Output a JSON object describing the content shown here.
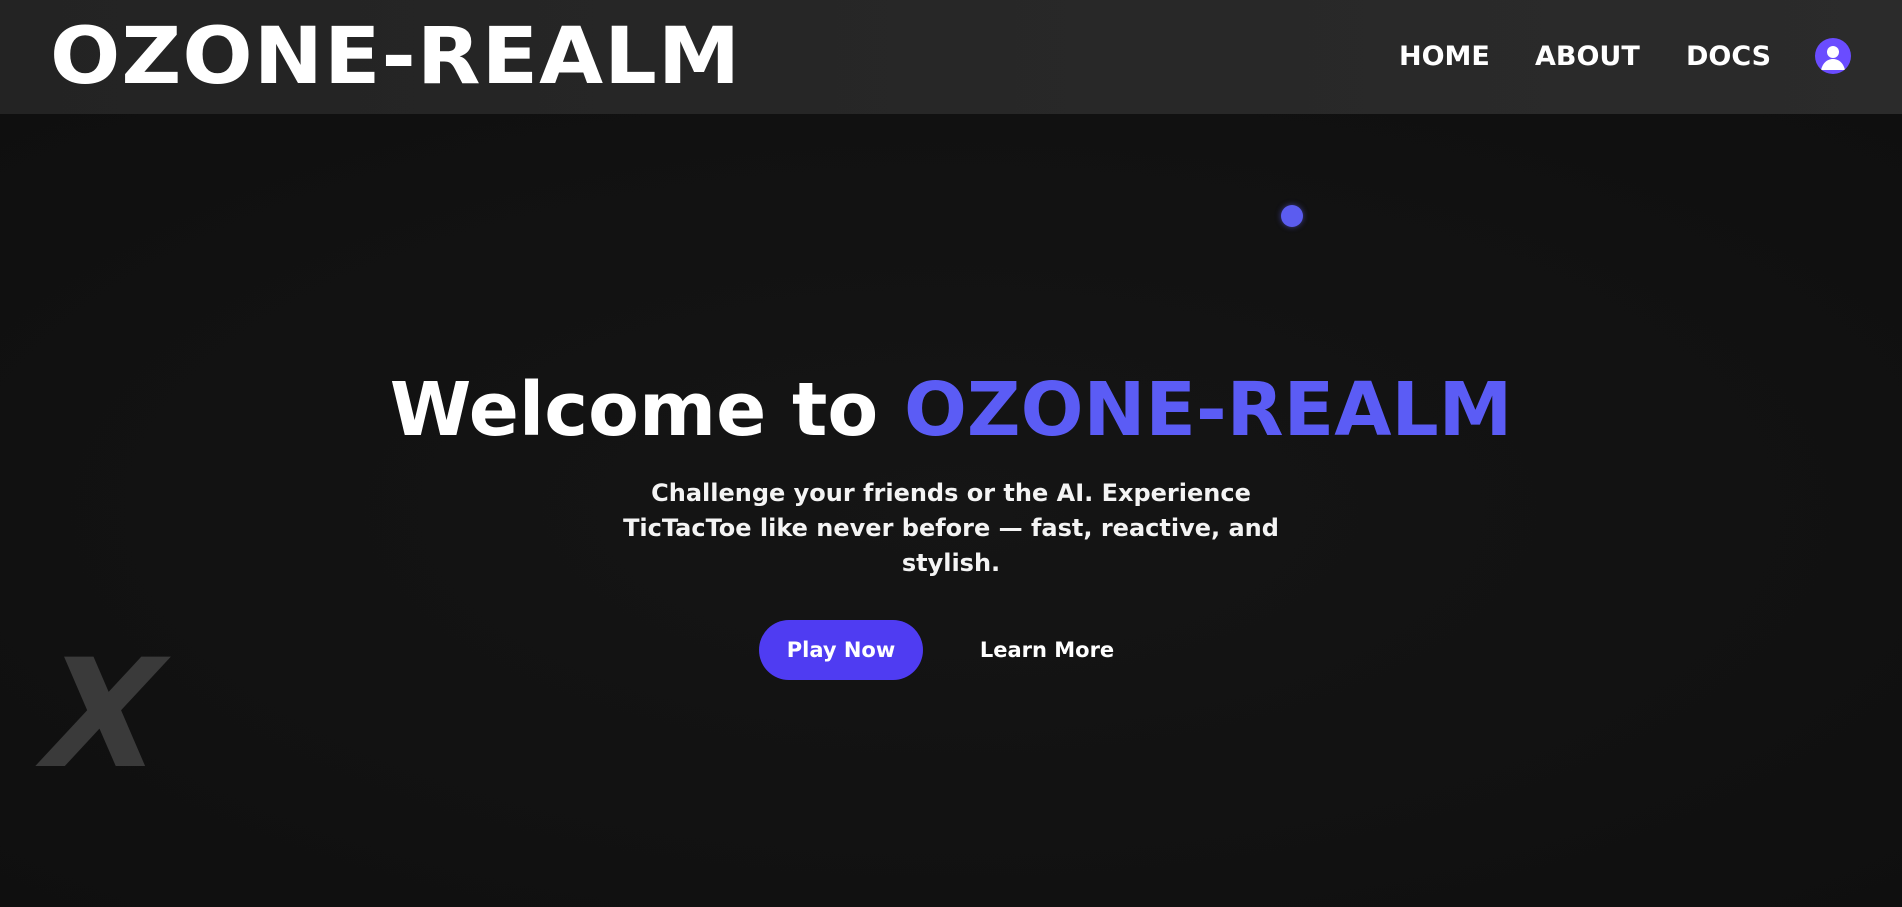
{
  "header": {
    "logo": "OZONE-REALM",
    "nav": {
      "home": "HOME",
      "about": "ABOUT",
      "docs": "DOCS"
    },
    "avatar_icon": "user-avatar-icon"
  },
  "hero": {
    "title_prefix": "Welcome to ",
    "title_brand": "OZONE-REALM",
    "subtitle": "Challenge your friends or the AI. Experience TicTacToe like never before — fast, reactive, and stylish.",
    "play_label": "Play Now",
    "learn_label": "Learn More",
    "decoration_glyph": "X"
  },
  "colors": {
    "background": "#121212",
    "header": "#2a2a2a",
    "accent": "#5b5cf5",
    "button": "#4f3cf2",
    "avatar": "#6a4cff"
  }
}
